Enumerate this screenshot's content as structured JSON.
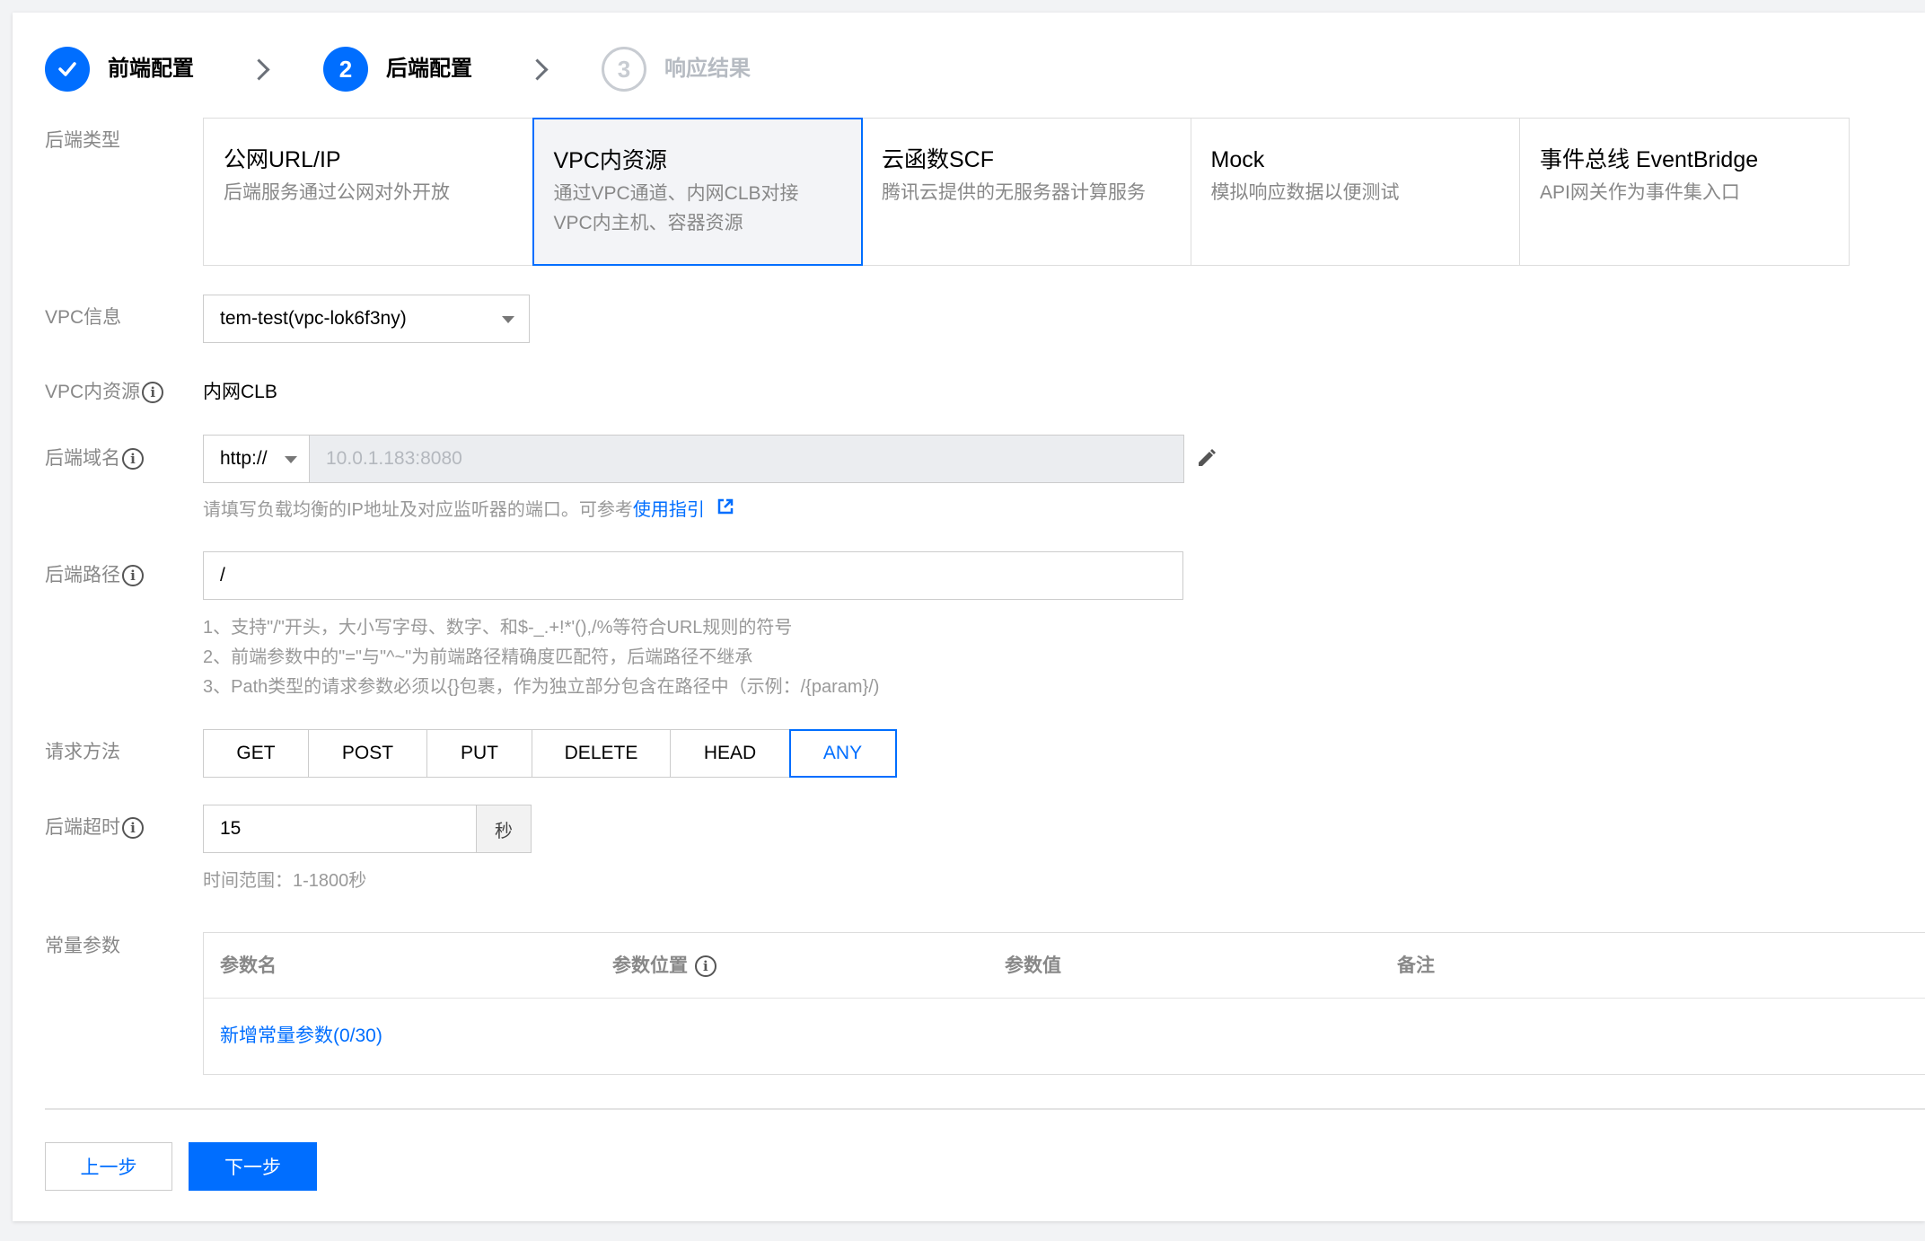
{
  "steps": [
    {
      "index": "✓",
      "label": "前端配置",
      "state": "done"
    },
    {
      "index": "2",
      "label": "后端配置",
      "state": "current"
    },
    {
      "index": "3",
      "label": "响应结果",
      "state": "todo"
    }
  ],
  "backend_type": {
    "label": "后端类型",
    "options": [
      {
        "title": "公网URL/IP",
        "desc": [
          "后端服务通过公网对外开放"
        ],
        "selected": false
      },
      {
        "title": "VPC内资源",
        "desc": [
          "通过VPC通道、内网CLB对接",
          "VPC内主机、容器资源"
        ],
        "selected": true
      },
      {
        "title": "云函数SCF",
        "desc": [
          "腾讯云提供的无服务器计算服务"
        ],
        "selected": false
      },
      {
        "title": "Mock",
        "desc": [
          "模拟响应数据以便测试"
        ],
        "selected": false
      },
      {
        "title": "事件总线 EventBridge",
        "desc": [
          "API网关作为事件集入口"
        ],
        "selected": false
      }
    ]
  },
  "vpc_info": {
    "label": "VPC信息",
    "value": "tem-test(vpc-lok6f3ny)"
  },
  "vpc_resource": {
    "label": "VPC内资源",
    "value": "内网CLB"
  },
  "backend_domain": {
    "label": "后端域名",
    "protocol": "http://",
    "value": "10.0.1.183:8080",
    "help_prefix": "请填写负载均衡的IP地址及对应监听器的端口。可参考",
    "help_link": "使用指引",
    "edit_icon": "pencil-icon"
  },
  "backend_path": {
    "label": "后端路径",
    "value": "/",
    "help": [
      "1、支持\"/\"开头，大小写字母、数字、和$-_.+!*'(),/%等符合URL规则的符号",
      "2、前端参数中的\"=\"与\"^~\"为前端路径精确度匹配符，后端路径不继承",
      "3、Path类型的请求参数必须以{}包裹，作为独立部分包含在路径中（示例：/{param}/)"
    ]
  },
  "request_method": {
    "label": "请求方法",
    "options": [
      "GET",
      "POST",
      "PUT",
      "DELETE",
      "HEAD",
      "ANY"
    ],
    "selected": "ANY"
  },
  "backend_timeout": {
    "label": "后端超时",
    "value": "15",
    "unit": "秒",
    "help": "时间范围：1-1800秒"
  },
  "constant_params": {
    "label": "常量参数",
    "columns": [
      "参数名",
      "参数位置",
      "参数值",
      "备注"
    ],
    "add_link": "新增常量参数(0/30)"
  },
  "footer": {
    "prev": "上一步",
    "next": "下一步"
  },
  "colors": {
    "accent": "#006eff",
    "muted": "#888888"
  }
}
